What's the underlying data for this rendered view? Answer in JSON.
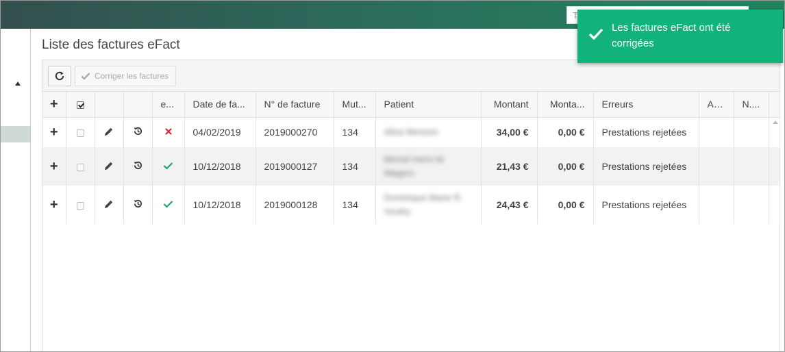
{
  "header": {
    "search_placeholder": "T"
  },
  "page": {
    "title": "Liste des factures eFact"
  },
  "toolbar": {
    "fix_label": "Corriger les factures"
  },
  "table": {
    "columns": [
      "e...",
      "Date de fa...",
      "N° de facture",
      "Mut...",
      "Patient",
      "Montant",
      "Monta...",
      "Erreurs",
      "As...",
      "N...."
    ],
    "rows": [
      {
        "status": "rejected",
        "date": "04/02/2019",
        "invoice": "2019000270",
        "mut": "134",
        "patient": "Alina Mertzen",
        "amount": "34,00 €",
        "amount2": "0,00 €",
        "errors": "Prestations rejetées"
      },
      {
        "status": "ok",
        "date": "10/12/2018",
        "invoice": "2019000127",
        "mut": "134",
        "patient": "Michel Henri M. Wagers",
        "amount": "21,43 €",
        "amount2": "0,00 €",
        "errors": "Prestations rejetées"
      },
      {
        "status": "ok",
        "date": "10/12/2018",
        "invoice": "2019000128",
        "mut": "134",
        "patient": "Dominique Marie R. Vouley",
        "amount": "24,43 €",
        "amount2": "0,00 €",
        "errors": "Prestations rejetées"
      }
    ]
  },
  "toast": {
    "message": "Les factures eFact ont été corrigées"
  },
  "colors": {
    "header_start": "#344f4d",
    "header_end": "#22845f",
    "toast": "#12b37b",
    "ok": "#1aa36b",
    "error": "#d9272e"
  },
  "icons": [
    "refresh-icon",
    "check-icon",
    "plus-icon",
    "pencil-icon",
    "history-icon",
    "x-icon",
    "chevron-up-icon"
  ]
}
